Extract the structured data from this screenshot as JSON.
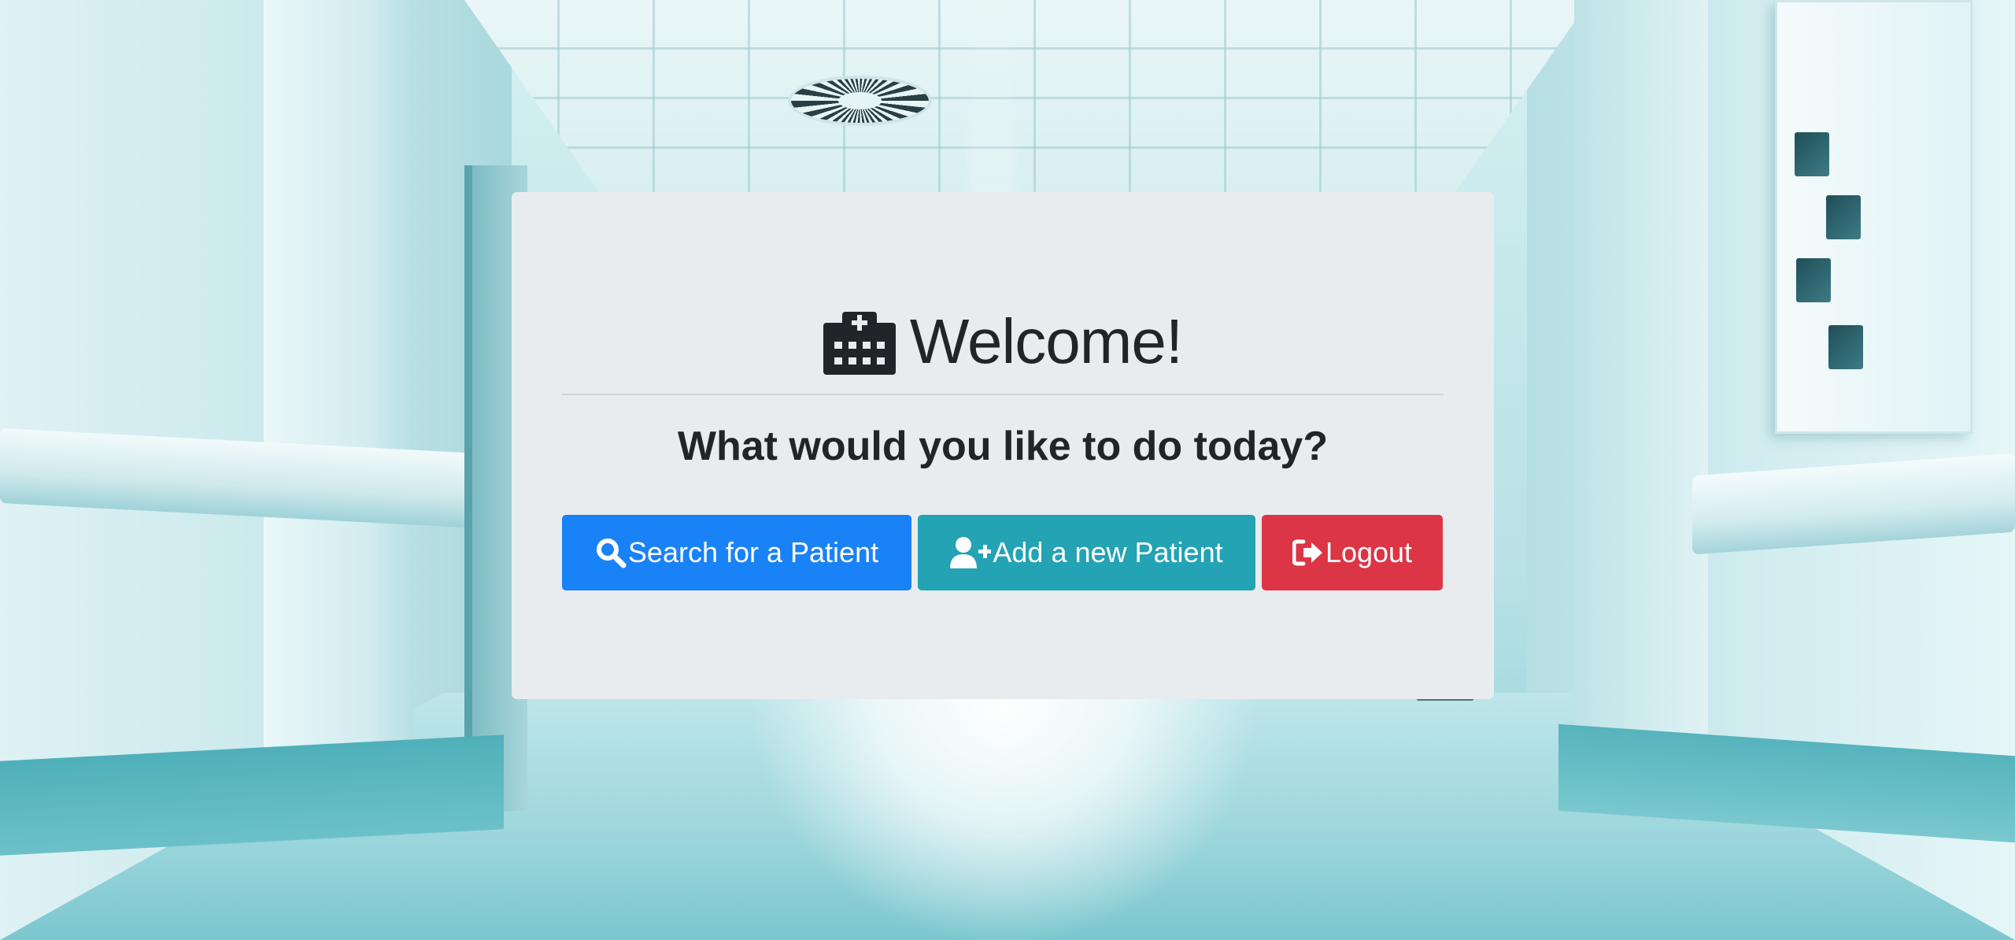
{
  "card": {
    "title": "Welcome!",
    "title_icon": "hospital-icon",
    "subtitle": "What would you like to do today?"
  },
  "actions": {
    "search": {
      "label": "Search for a Patient",
      "icon": "search-icon",
      "color": "#1a82f7"
    },
    "add": {
      "label": "Add a new Patient",
      "icon": "user-plus-icon",
      "color": "#23a3b4"
    },
    "logout": {
      "label": "Logout",
      "icon": "sign-out-icon",
      "color": "#dc3545"
    }
  },
  "background": {
    "description_icon": "hospital-corridor-background"
  }
}
